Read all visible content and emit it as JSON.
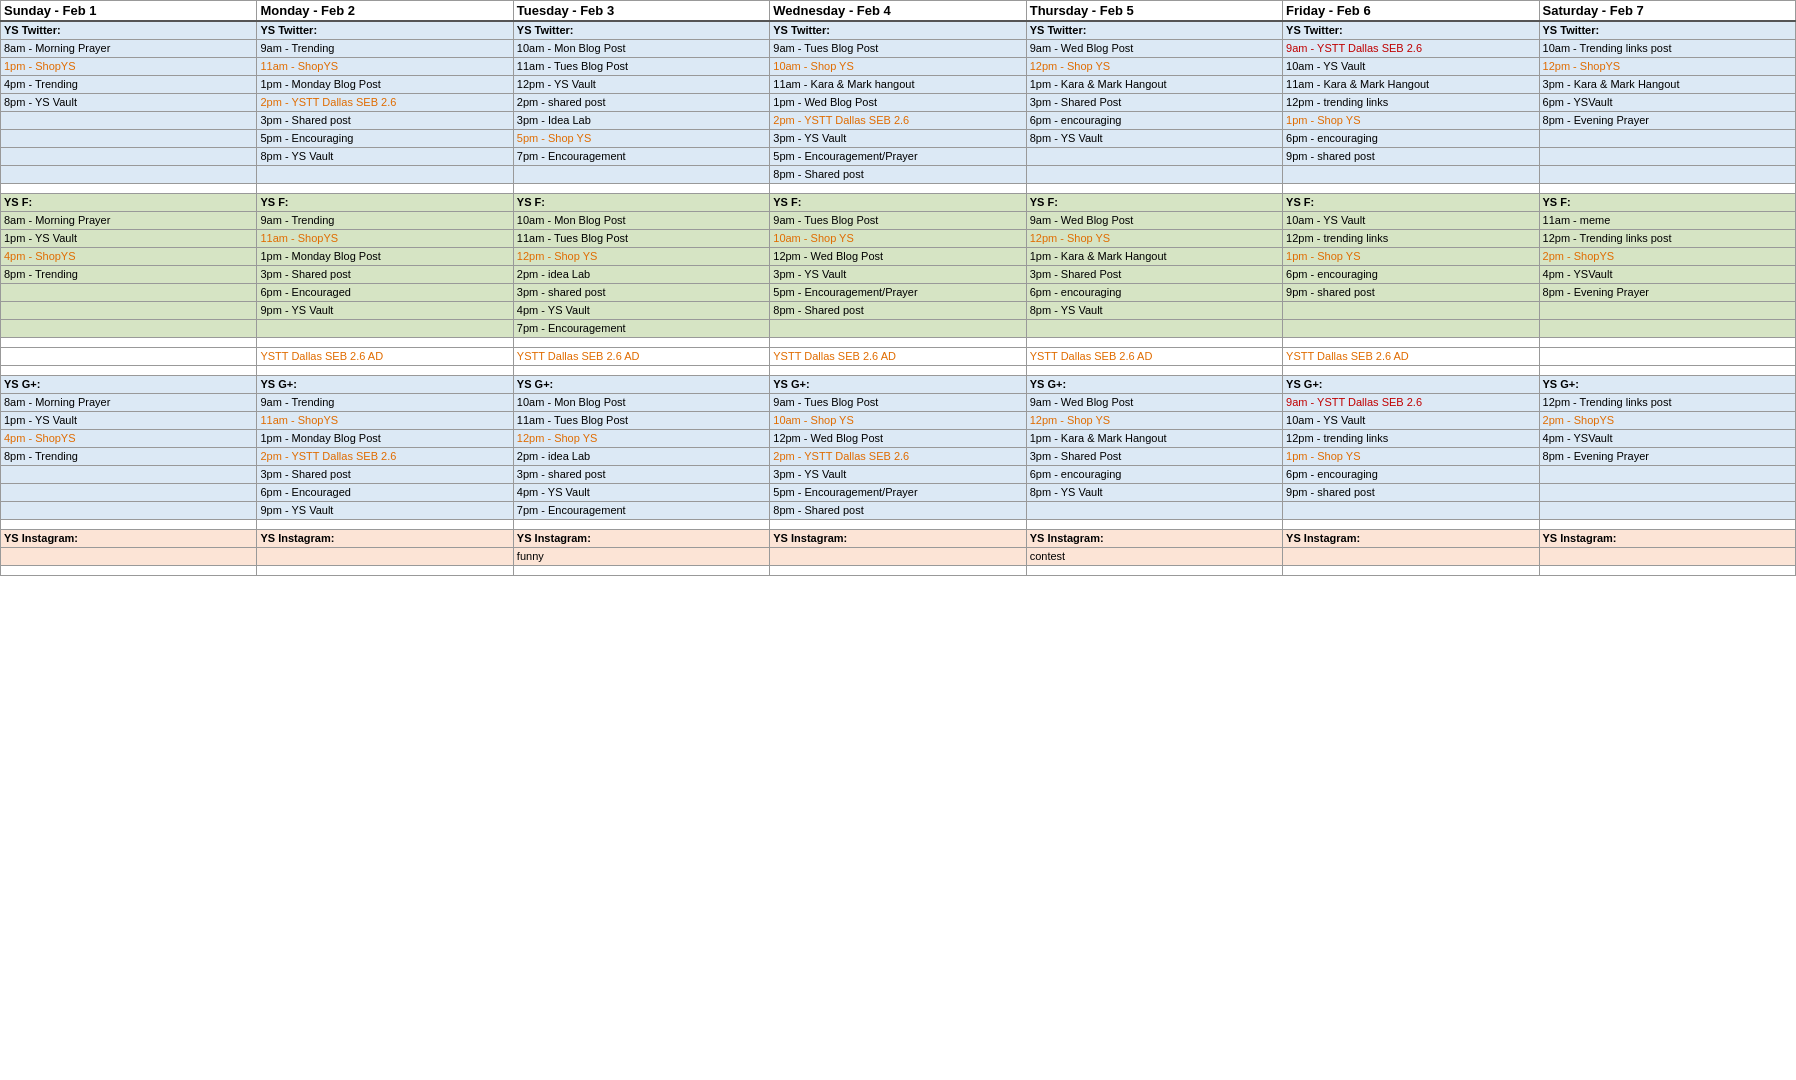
{
  "headers": [
    "Sunday - Feb 1",
    "Monday - Feb 2",
    "Tuesday - Feb 3",
    "Wednesday - Feb 4",
    "Thursday - Feb 5",
    "Friday - Feb 6",
    "Saturday - Feb 7"
  ],
  "sections": [
    {
      "id": "twitter",
      "label": "YS Twitter:",
      "bg": "blue",
      "cols": [
        {
          "items": [
            {
              "text": "8am - Morning Prayer",
              "color": ""
            },
            {
              "text": "1pm - ShopYS",
              "color": "orange"
            },
            {
              "text": "4pm - Trending",
              "color": ""
            },
            {
              "text": "8pm - YS Vault",
              "color": ""
            }
          ]
        },
        {
          "items": [
            {
              "text": "9am - Trending",
              "color": ""
            },
            {
              "text": "11am - ShopYS",
              "color": "orange"
            },
            {
              "text": "1pm - Monday Blog Post",
              "color": ""
            },
            {
              "text": "2pm - YSTT Dallas SEB 2.6",
              "color": "orange"
            },
            {
              "text": "3pm - Shared post",
              "color": ""
            },
            {
              "text": "5pm - Encouraging",
              "color": ""
            },
            {
              "text": "8pm - YS Vault",
              "color": ""
            }
          ]
        },
        {
          "items": [
            {
              "text": "10am - Mon Blog Post",
              "color": ""
            },
            {
              "text": "11am - Tues Blog Post",
              "color": ""
            },
            {
              "text": "12pm - YS Vault",
              "color": ""
            },
            {
              "text": "2pm - shared post",
              "color": ""
            },
            {
              "text": "3pm - Idea Lab",
              "color": ""
            },
            {
              "text": "5pm - Shop YS",
              "color": "orange"
            },
            {
              "text": "7pm - Encouragement",
              "color": ""
            }
          ]
        },
        {
          "items": [
            {
              "text": "9am - Tues Blog Post",
              "color": ""
            },
            {
              "text": "10am - Shop YS",
              "color": "orange"
            },
            {
              "text": "11am - Kara & Mark hangout",
              "color": ""
            },
            {
              "text": "1pm - Wed Blog Post",
              "color": ""
            },
            {
              "text": "2pm - YSTT Dallas SEB 2.6",
              "color": "orange"
            },
            {
              "text": "3pm - YS Vault",
              "color": ""
            },
            {
              "text": "5pm - Encouragement/Prayer",
              "color": ""
            },
            {
              "text": "8pm - Shared post",
              "color": ""
            }
          ]
        },
        {
          "items": [
            {
              "text": "9am - Wed Blog Post",
              "color": ""
            },
            {
              "text": "12pm - Shop YS",
              "color": "orange"
            },
            {
              "text": "1pm - Kara & Mark Hangout",
              "color": ""
            },
            {
              "text": "3pm - Shared Post",
              "color": ""
            },
            {
              "text": "6pm - encouraging",
              "color": ""
            },
            {
              "text": "8pm - YS Vault",
              "color": ""
            }
          ]
        },
        {
          "items": [
            {
              "text": "9am - YSTT Dallas SEB 2.6",
              "color": "red"
            },
            {
              "text": "10am - YS Vault",
              "color": ""
            },
            {
              "text": "11am - Kara & Mark Hangout",
              "color": ""
            },
            {
              "text": "12pm - trending links",
              "color": ""
            },
            {
              "text": "1pm - Shop YS",
              "color": "orange"
            },
            {
              "text": "6pm - encouraging",
              "color": ""
            },
            {
              "text": "9pm - shared post",
              "color": ""
            }
          ]
        },
        {
          "items": [
            {
              "text": "10am - Trending links post",
              "color": ""
            },
            {
              "text": "12pm - ShopYS",
              "color": "orange"
            },
            {
              "text": "3pm - Kara & Mark Hangout",
              "color": ""
            },
            {
              "text": "6pm - YSVault",
              "color": ""
            },
            {
              "text": "8pm - Evening Prayer",
              "color": ""
            }
          ]
        }
      ]
    },
    {
      "id": "ysf",
      "label": "YS F:",
      "bg": "green",
      "cols": [
        {
          "items": [
            {
              "text": "8am - Morning Prayer",
              "color": ""
            },
            {
              "text": "1pm - YS Vault",
              "color": ""
            },
            {
              "text": "4pm - ShopYS",
              "color": "orange"
            },
            {
              "text": "8pm - Trending",
              "color": ""
            }
          ]
        },
        {
          "items": [
            {
              "text": "9am - Trending",
              "color": ""
            },
            {
              "text": "11am - ShopYS",
              "color": "orange"
            },
            {
              "text": "1pm - Monday Blog Post",
              "color": ""
            },
            {
              "text": "3pm - Shared post",
              "color": ""
            },
            {
              "text": "6pm - Encouraged",
              "color": ""
            },
            {
              "text": "9pm - YS Vault",
              "color": ""
            }
          ]
        },
        {
          "items": [
            {
              "text": "10am - Mon Blog Post",
              "color": ""
            },
            {
              "text": "11am - Tues Blog Post",
              "color": ""
            },
            {
              "text": "12pm - Shop YS",
              "color": "orange"
            },
            {
              "text": "2pm - idea Lab",
              "color": ""
            },
            {
              "text": "3pm - shared post",
              "color": ""
            },
            {
              "text": "4pm - YS Vault",
              "color": ""
            },
            {
              "text": "7pm - Encouragement",
              "color": ""
            }
          ]
        },
        {
          "items": [
            {
              "text": "9am - Tues Blog Post",
              "color": ""
            },
            {
              "text": "10am - Shop YS",
              "color": "orange"
            },
            {
              "text": "12pm - Wed Blog Post",
              "color": ""
            },
            {
              "text": "3pm - YS Vault",
              "color": ""
            },
            {
              "text": "5pm - Encouragement/Prayer",
              "color": ""
            },
            {
              "text": "8pm - Shared post",
              "color": ""
            }
          ]
        },
        {
          "items": [
            {
              "text": "9am - Wed Blog Post",
              "color": ""
            },
            {
              "text": "12pm - Shop YS",
              "color": "orange"
            },
            {
              "text": "1pm - Kara & Mark Hangout",
              "color": ""
            },
            {
              "text": "3pm - Shared Post",
              "color": ""
            },
            {
              "text": "6pm - encouraging",
              "color": ""
            },
            {
              "text": "8pm - YS Vault",
              "color": ""
            }
          ]
        },
        {
          "items": [
            {
              "text": "10am - YS Vault",
              "color": ""
            },
            {
              "text": "12pm - trending links",
              "color": ""
            },
            {
              "text": "1pm - Shop YS",
              "color": "orange"
            },
            {
              "text": "6pm - encouraging",
              "color": ""
            },
            {
              "text": "9pm - shared post",
              "color": ""
            }
          ]
        },
        {
          "items": [
            {
              "text": "11am - meme",
              "color": ""
            },
            {
              "text": "12pm - Trending links post",
              "color": ""
            },
            {
              "text": "2pm - ShopYS",
              "color": "orange"
            },
            {
              "text": "4pm - YSVault",
              "color": ""
            },
            {
              "text": "8pm - Evening Prayer",
              "color": ""
            }
          ]
        }
      ]
    },
    {
      "id": "ad",
      "label": "",
      "bg": "white",
      "isAd": true,
      "cols": [
        {
          "text": "",
          "color": ""
        },
        {
          "text": "YSTT Dallas SEB 2.6 AD",
          "color": "orange"
        },
        {
          "text": "YSTT Dallas SEB 2.6 AD",
          "color": "orange"
        },
        {
          "text": "YSTT Dallas SEB 2.6 AD",
          "color": "orange"
        },
        {
          "text": "YSTT Dallas SEB 2.6 AD",
          "color": "orange"
        },
        {
          "text": "YSTT Dallas SEB 2.6 AD",
          "color": "orange"
        },
        {
          "text": "",
          "color": ""
        }
      ]
    },
    {
      "id": "gplus",
      "label": "YS G+:",
      "bg": "blue",
      "cols": [
        {
          "items": [
            {
              "text": "8am - Morning Prayer",
              "color": ""
            },
            {
              "text": "1pm - YS Vault",
              "color": ""
            },
            {
              "text": "4pm - ShopYS",
              "color": "orange"
            },
            {
              "text": "8pm - Trending",
              "color": ""
            }
          ]
        },
        {
          "items": [
            {
              "text": "9am - Trending",
              "color": ""
            },
            {
              "text": "11am - ShopYS",
              "color": "orange"
            },
            {
              "text": "1pm - Monday Blog Post",
              "color": ""
            },
            {
              "text": "2pm - YSTT Dallas SEB 2.6",
              "color": "orange"
            },
            {
              "text": "3pm - Shared post",
              "color": ""
            },
            {
              "text": "6pm - Encouraged",
              "color": ""
            },
            {
              "text": "9pm - YS Vault",
              "color": ""
            }
          ]
        },
        {
          "items": [
            {
              "text": "10am - Mon Blog Post",
              "color": ""
            },
            {
              "text": "11am - Tues Blog Post",
              "color": ""
            },
            {
              "text": "12pm - Shop YS",
              "color": "orange"
            },
            {
              "text": "2pm - idea Lab",
              "color": ""
            },
            {
              "text": "3pm - shared post",
              "color": ""
            },
            {
              "text": "4pm - YS Vault",
              "color": ""
            },
            {
              "text": "7pm - Encouragement",
              "color": ""
            }
          ]
        },
        {
          "items": [
            {
              "text": "9am - Tues Blog Post",
              "color": ""
            },
            {
              "text": "10am - Shop YS",
              "color": "orange"
            },
            {
              "text": "12pm - Wed Blog Post",
              "color": ""
            },
            {
              "text": "2pm - YSTT Dallas SEB 2.6",
              "color": "orange"
            },
            {
              "text": "3pm - YS Vault",
              "color": ""
            },
            {
              "text": "5pm - Encouragement/Prayer",
              "color": ""
            },
            {
              "text": "8pm - Shared post",
              "color": ""
            }
          ]
        },
        {
          "items": [
            {
              "text": "9am - Wed Blog Post",
              "color": ""
            },
            {
              "text": "12pm - Shop YS",
              "color": "orange"
            },
            {
              "text": "1pm - Kara & Mark Hangout",
              "color": ""
            },
            {
              "text": "3pm - Shared Post",
              "color": ""
            },
            {
              "text": "6pm - encouraging",
              "color": ""
            },
            {
              "text": "8pm - YS Vault",
              "color": ""
            }
          ]
        },
        {
          "items": [
            {
              "text": "9am - YSTT Dallas SEB 2.6",
              "color": "red"
            },
            {
              "text": "10am - YS Vault",
              "color": ""
            },
            {
              "text": "12pm - trending links",
              "color": ""
            },
            {
              "text": "1pm - Shop YS",
              "color": "orange"
            },
            {
              "text": "6pm - encouraging",
              "color": ""
            },
            {
              "text": "9pm - shared post",
              "color": ""
            }
          ]
        },
        {
          "items": [
            {
              "text": "12pm - Trending links post",
              "color": ""
            },
            {
              "text": "2pm - ShopYS",
              "color": "orange"
            },
            {
              "text": "4pm - YSVault",
              "color": ""
            },
            {
              "text": "8pm - Evening Prayer",
              "color": ""
            }
          ]
        }
      ]
    },
    {
      "id": "instagram",
      "label": "YS Instagram:",
      "bg": "peach",
      "cols": [
        {
          "items": []
        },
        {
          "items": []
        },
        {
          "items": [
            {
              "text": "funny",
              "color": ""
            }
          ]
        },
        {
          "items": []
        },
        {
          "items": [
            {
              "text": "contest",
              "color": ""
            }
          ]
        },
        {
          "items": []
        },
        {
          "items": []
        }
      ]
    }
  ]
}
